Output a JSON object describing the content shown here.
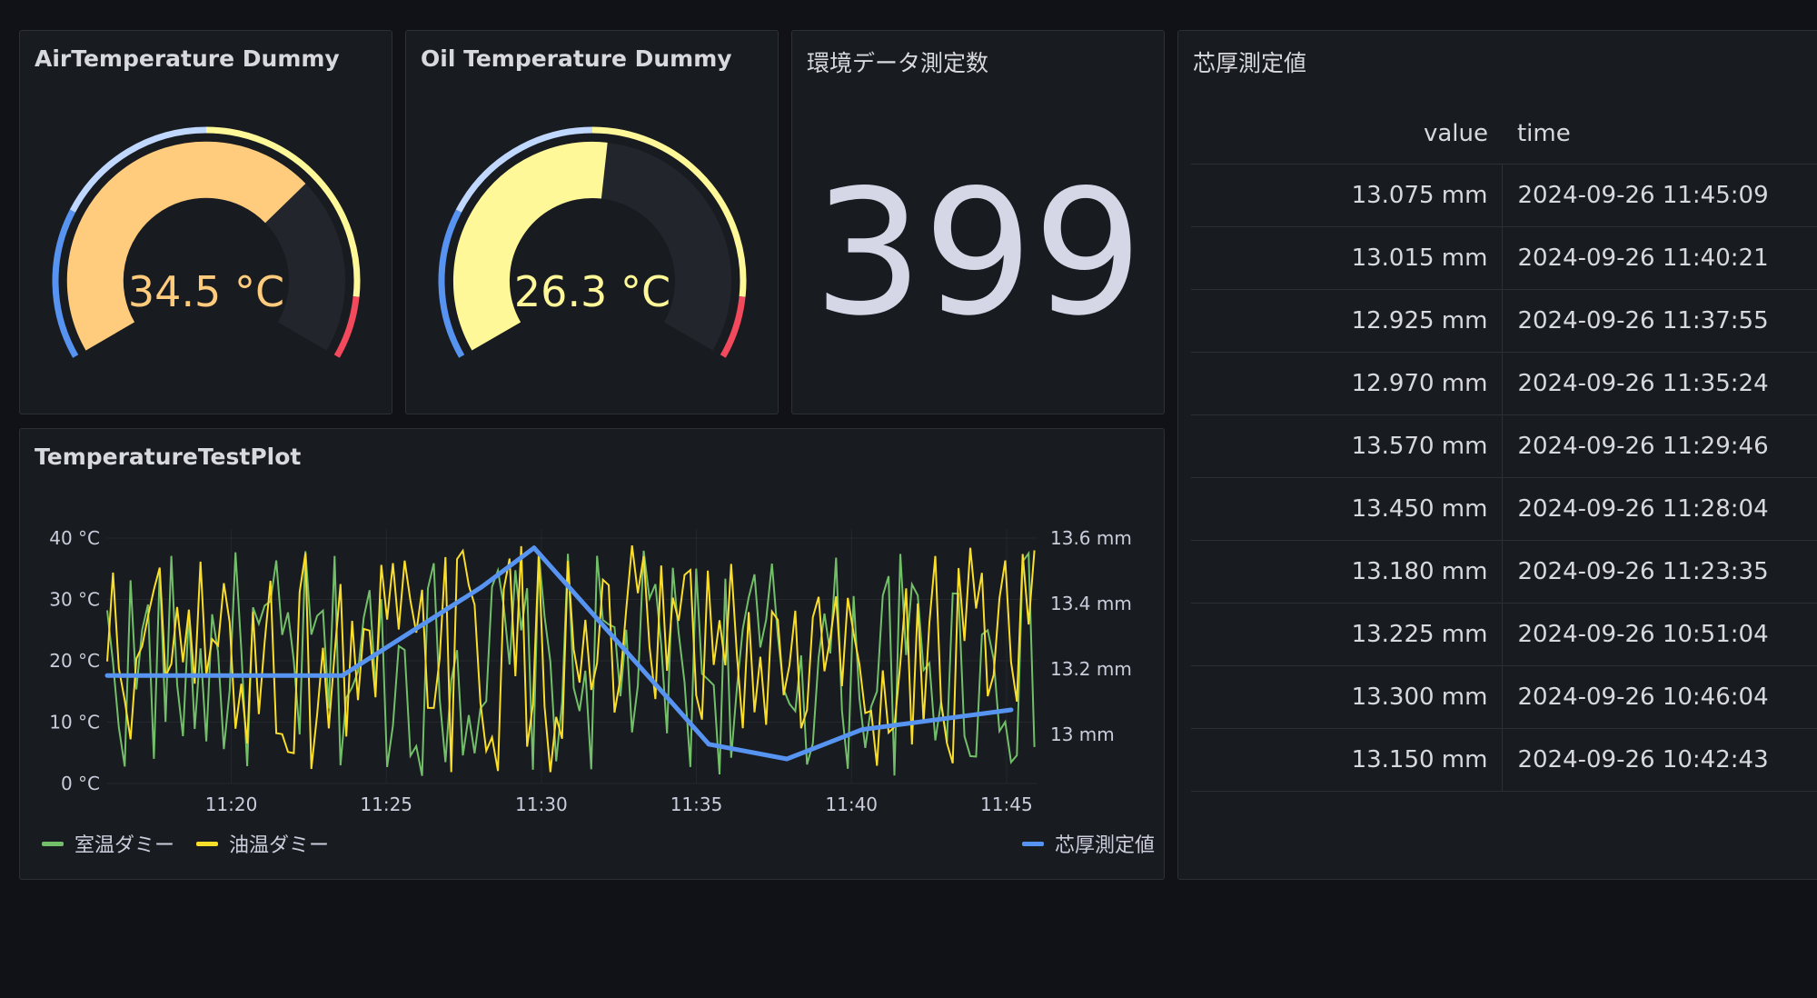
{
  "gauges": [
    {
      "title": "AirTemperature Dummy",
      "value": 34.5,
      "display": "34.5 °C",
      "color": "#ffcb7d"
    },
    {
      "title": "Oil Temperature Dummy",
      "value": 26.3,
      "display": "26.3 °C",
      "color": "#fff899"
    }
  ],
  "stat": {
    "title": "環境データ測定数",
    "value": "399",
    "color": "#d5d6e6"
  },
  "table": {
    "title": "芯厚測定値",
    "columns": [
      "value",
      "time"
    ],
    "rows": [
      [
        "13.075 mm",
        "2024-09-26 11:45:09"
      ],
      [
        "13.015 mm",
        "2024-09-26 11:40:21"
      ],
      [
        "12.925 mm",
        "2024-09-26 11:37:55"
      ],
      [
        "12.970 mm",
        "2024-09-26 11:35:24"
      ],
      [
        "13.570 mm",
        "2024-09-26 11:29:46"
      ],
      [
        "13.450 mm",
        "2024-09-26 11:28:04"
      ],
      [
        "13.180 mm",
        "2024-09-26 11:23:35"
      ],
      [
        "13.225 mm",
        "2024-09-26 10:51:04"
      ],
      [
        "13.300 mm",
        "2024-09-26 10:46:04"
      ],
      [
        "13.150 mm",
        "2024-09-26 10:42:43"
      ]
    ]
  },
  "plot": {
    "title": "TemperatureTestPlot",
    "legend_left": [
      "室温ダミー",
      "油温ダミー"
    ],
    "legend_right": [
      "芯厚測定値"
    ]
  },
  "chart_data": {
    "type": "line",
    "x_range": [
      "11:16",
      "11:46"
    ],
    "x_ticks": [
      "11:20",
      "11:25",
      "11:30",
      "11:35",
      "11:40",
      "11:45"
    ],
    "y_left": {
      "ticks": [
        "0 °C",
        "10 °C",
        "20 °C",
        "30 °C",
        "40 °C"
      ],
      "range": [
        0,
        40
      ]
    },
    "y_right": {
      "ticks": [
        "13 mm",
        "13.2 mm",
        "13.4 mm",
        "13.6 mm"
      ],
      "range": [
        12.85,
        13.6
      ]
    },
    "series": [
      {
        "name": "室温ダミー",
        "color": "#73bf69",
        "axis": "left",
        "pattern": "random",
        "min": 1,
        "max": 38
      },
      {
        "name": "油温ダミー",
        "color": "#fade2a",
        "axis": "left",
        "pattern": "random",
        "min": 1,
        "max": 39
      },
      {
        "name": "芯厚測定値",
        "color": "#5794f2",
        "axis": "right",
        "x": [
          "11:16",
          "11:23:35",
          "11:28:04",
          "11:29:46",
          "11:35:24",
          "11:37:55",
          "11:40:21",
          "11:45:09"
        ],
        "y": [
          13.18,
          13.18,
          13.45,
          13.57,
          12.97,
          12.925,
          13.015,
          13.075
        ]
      }
    ]
  },
  "colors": {
    "bg": "#111217",
    "panel": "#181b1f",
    "border": "#2c2f35",
    "gauge_low": "#5794f2",
    "gauge_threshold_light": "#c0d8ff",
    "gauge_warm": "#fff899",
    "gauge_high": "#f2495c"
  }
}
